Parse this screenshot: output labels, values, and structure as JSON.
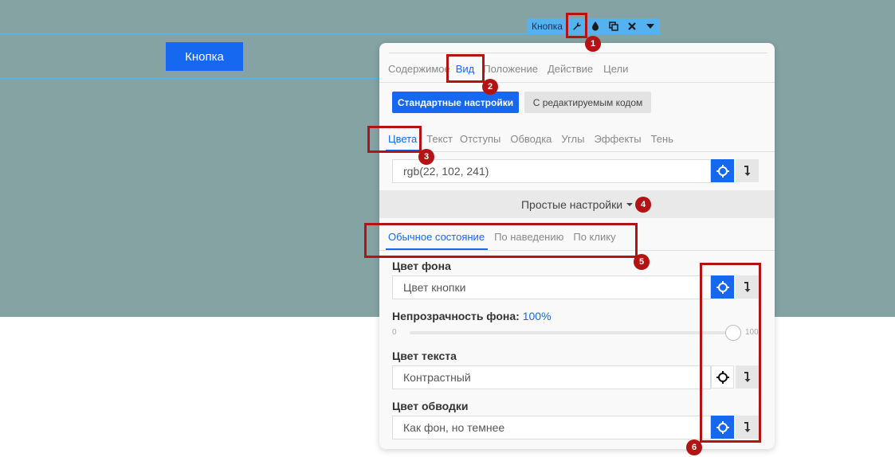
{
  "page": {
    "button_label": "Кнопка"
  },
  "toolbar": {
    "element_label": "Кнопка",
    "icons": [
      "wrench-icon",
      "drop-icon",
      "duplicate-icon",
      "close-icon",
      "chevron-down-icon"
    ]
  },
  "panel": {
    "main_tabs": [
      {
        "label": "Содержимое",
        "active": false
      },
      {
        "label": "Вид",
        "active": true
      },
      {
        "label": "Положение",
        "active": false
      },
      {
        "label": "Действие",
        "active": false
      },
      {
        "label": "Цели",
        "active": false
      }
    ],
    "mode_buttons": {
      "standard": "Стандартные настройки",
      "custom_code": "С редактируемым кодом"
    },
    "sub_tabs": [
      {
        "label": "Цвета",
        "active": true
      },
      {
        "label": "Текст",
        "active": false
      },
      {
        "label": "Отступы",
        "active": false
      },
      {
        "label": "Обводка",
        "active": false
      },
      {
        "label": "Углы",
        "active": false
      },
      {
        "label": "Эффекты",
        "active": false
      },
      {
        "label": "Тень",
        "active": false
      }
    ],
    "color_value": "rgb(22, 102, 241)",
    "simple_settings_label": "Простые настройки",
    "state_tabs": [
      {
        "label": "Обычное состояние",
        "active": true
      },
      {
        "label": "По наведению",
        "active": false
      },
      {
        "label": "По клику",
        "active": false
      }
    ],
    "bg_color": {
      "label": "Цвет фона",
      "value": "Цвет кнопки"
    },
    "bg_opacity": {
      "label": "Непрозрачность фона:",
      "value_text": "100%",
      "value": 100,
      "min_label": "0",
      "max_label": "100"
    },
    "text_color": {
      "label": "Цвет текста",
      "value": "Контрастный"
    },
    "border_color": {
      "label": "Цвет обводки",
      "value": "Как фон, но темнее"
    }
  },
  "annotations": [
    "1",
    "2",
    "3",
    "4",
    "5",
    "6"
  ],
  "colors": {
    "canvas_bg": "#84a3a2",
    "accent": "#1668f1",
    "toolbar": "#54b2f0",
    "annotation_red": "#b41313"
  }
}
